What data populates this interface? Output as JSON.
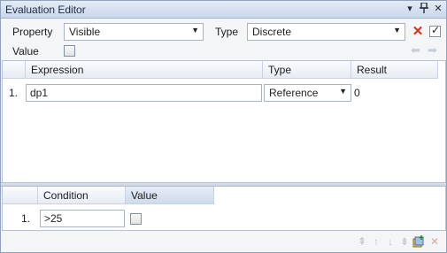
{
  "window": {
    "title": "Evaluation Editor"
  },
  "titlebar_buttons": [
    {
      "name": "dropdown-icon",
      "glyph": "▾"
    },
    {
      "name": "pin-icon",
      "glyph": "⊥"
    },
    {
      "name": "close-icon",
      "glyph": "✕"
    }
  ],
  "property": {
    "label": "Property",
    "value": "Visible"
  },
  "type": {
    "label": "Type",
    "value": "Discrete"
  },
  "value": {
    "label": "Value",
    "checked": false
  },
  "expressions": {
    "headers": [
      "Expression",
      "Type",
      "Result"
    ],
    "rows": [
      {
        "index": "1.",
        "expression": "dp1",
        "type": "Reference",
        "result": "0"
      }
    ]
  },
  "conditions": {
    "headers": [
      "Condition",
      "Value"
    ],
    "rows": [
      {
        "index": "1.",
        "condition": ">25",
        "checked": false
      }
    ]
  },
  "colors": {
    "remove": "#d0301f",
    "titlebar": "#cad7ea"
  }
}
